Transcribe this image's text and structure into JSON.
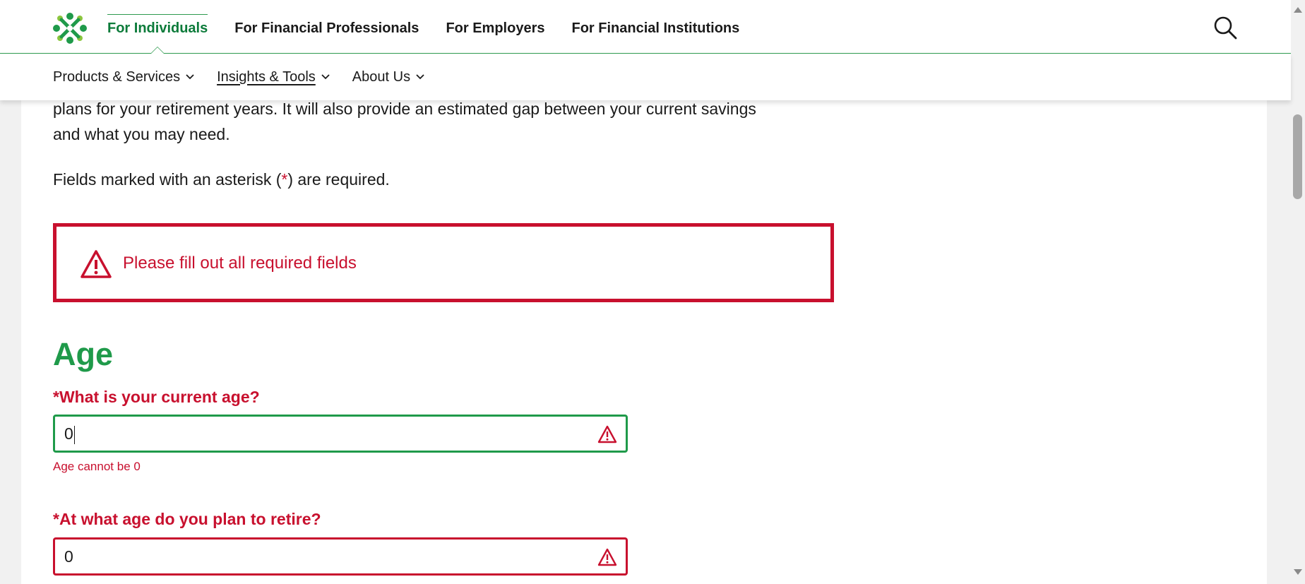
{
  "header": {
    "audience_tabs": [
      {
        "label": "For Individuals",
        "active": true
      },
      {
        "label": "For Financial Professionals",
        "active": false
      },
      {
        "label": "For Employers",
        "active": false
      },
      {
        "label": "For Financial Institutions",
        "active": false
      }
    ],
    "search_icon": "search-icon",
    "logo_icon": "brand-logo-icon"
  },
  "subnav": {
    "items": [
      {
        "label": "Products & Services",
        "underlined": false
      },
      {
        "label": "Insights & Tools",
        "underlined": true
      },
      {
        "label": "About Us",
        "underlined": false
      }
    ]
  },
  "intro": {
    "text_line1": "plans for your retirement years. It will also provide an estimated gap between your current savings",
    "text_line2": "and what you may need."
  },
  "required_note": {
    "prefix": "Fields marked with an asterisk (",
    "asterisk": "*",
    "suffix": ") are required."
  },
  "error_banner": {
    "message": "Please fill out all required fields",
    "icon": "warning-icon"
  },
  "section": {
    "title": "Age"
  },
  "fields": [
    {
      "label": "*What is your current age?",
      "value": "0",
      "focused": true,
      "error": "Age cannot be 0"
    },
    {
      "label": "*At what age do you plan to retire?",
      "value": "0",
      "focused": false,
      "error": ""
    }
  ],
  "colors": {
    "brand_green": "#1f9a4a",
    "active_tab_green": "#0c7b3a",
    "error_red": "#c8102e"
  }
}
